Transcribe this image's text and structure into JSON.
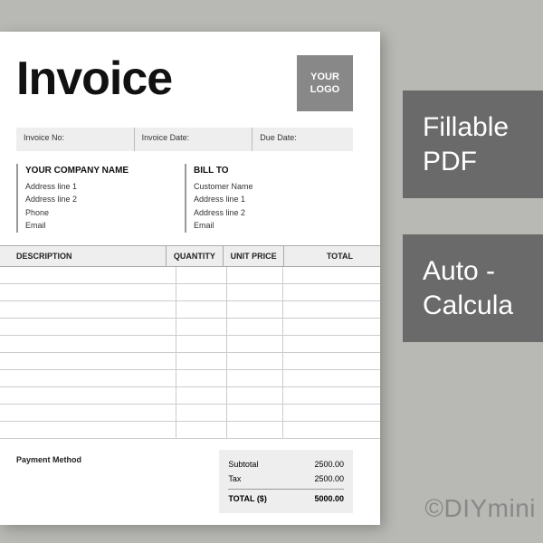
{
  "title": "Invoice",
  "logo_text": "YOUR LOGO",
  "meta": {
    "invoice_no": "Invoice No:",
    "invoice_date": "Invoice Date:",
    "due_date": "Due Date:"
  },
  "from": {
    "heading": "YOUR COMPANY NAME",
    "line1": "Address line 1",
    "line2": "Address line 2",
    "phone": "Phone",
    "email": "Email"
  },
  "bill_to": {
    "heading": "BILL TO",
    "name": "Customer Name",
    "line1": "Address line 1",
    "line2": "Address line 2",
    "email": "Email"
  },
  "columns": {
    "description": "DESCRIPTION",
    "quantity": "QUANTITY",
    "unit_price": "UNIT PRICE",
    "total": "TOTAL"
  },
  "row_count": 10,
  "payment_label": "Payment Method",
  "totals": {
    "subtotal_label": "Subtotal",
    "subtotal_value": "2500.00",
    "tax_label": "Tax",
    "tax_value": "2500.00",
    "total_label": "TOTAL ($)",
    "total_value": "5000.00"
  },
  "side": {
    "block1_line1": "Fillable",
    "block1_line2": "PDF",
    "block2_line1": "Auto -",
    "block2_line2": "Calcula"
  },
  "watermark": "©DIYmini"
}
